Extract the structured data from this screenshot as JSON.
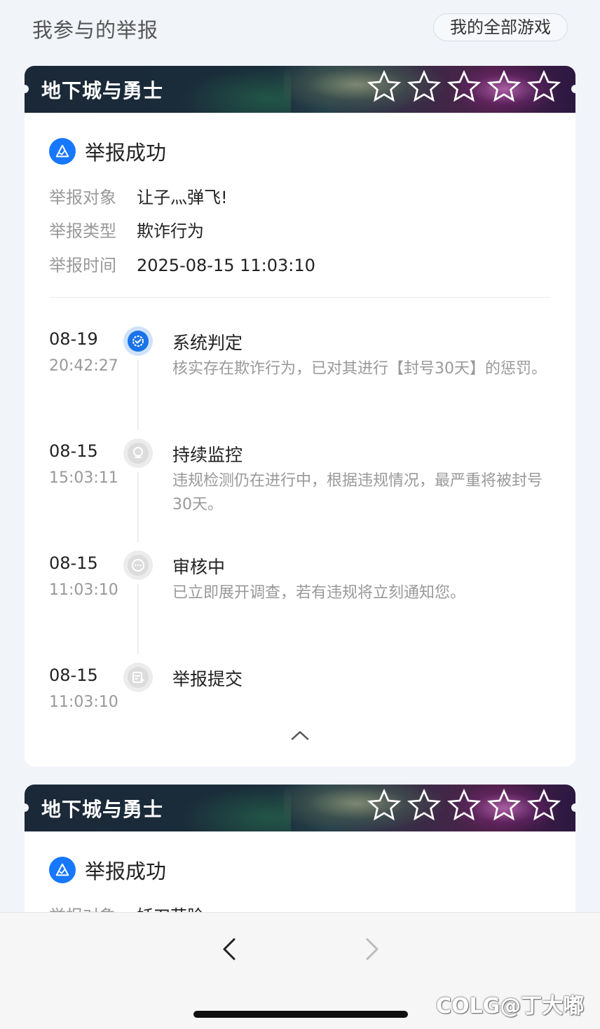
{
  "header": {
    "title": "我参与的举报",
    "all_games_button": "我的全部游戏"
  },
  "reports": [
    {
      "game_name": "地下城与勇士",
      "status": "举报成功",
      "info": [
        {
          "label": "举报对象",
          "value": "让子灬弹飞!"
        },
        {
          "label": "举报类型",
          "value": "欺诈行为"
        },
        {
          "label": "举报时间",
          "value": "2025-08-15 11:03:10"
        }
      ],
      "timeline": [
        {
          "date": "08-19",
          "time": "20:42:27",
          "title": "系统判定",
          "desc": "核实存在欺诈行为，已对其进行【封号30天】的惩罚。",
          "icon": "badge-check-icon",
          "active": true
        },
        {
          "date": "08-15",
          "time": "15:03:11",
          "title": "持续监控",
          "desc": "违规检测仍在进行中，根据违规情况，最严重将被封号30天。",
          "icon": "monitor-icon",
          "active": false
        },
        {
          "date": "08-15",
          "time": "11:03:10",
          "title": "审核中",
          "desc": "已立即展开调查，若有违规将立刻通知您。",
          "icon": "chat-icon",
          "active": false
        },
        {
          "date": "08-15",
          "time": "11:03:10",
          "title": "举报提交",
          "desc": "",
          "icon": "form-add-icon",
          "active": false
        }
      ]
    },
    {
      "game_name": "地下城与勇士",
      "status": "举报成功",
      "info": [
        {
          "label": "举报对象",
          "value": "妖刀花脸"
        }
      ]
    }
  ],
  "watermark": "COLG@丁大嘟",
  "colors": {
    "accent": "#1677ff",
    "page_bg": "#f1f4f9",
    "muted_text": "#999999"
  }
}
